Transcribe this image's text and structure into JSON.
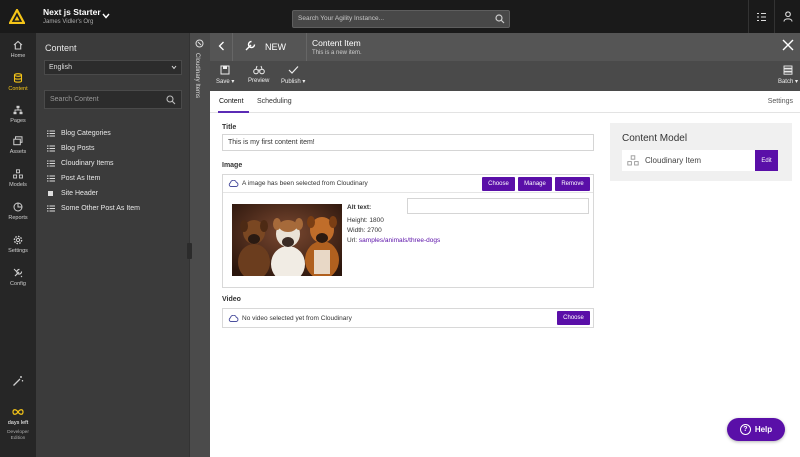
{
  "colors": {
    "accent": "#5a0fa8",
    "logo": "#f5c518",
    "topbar": "#1a1a1a"
  },
  "topbar": {
    "org_name": "Next js Starter",
    "org_sub": "James Vidler's Org",
    "search_placeholder": "Search Your Agility Instance..."
  },
  "nav": {
    "items": [
      {
        "label": "Home",
        "icon": "home-icon"
      },
      {
        "label": "Content",
        "icon": "database-icon"
      },
      {
        "label": "Pages",
        "icon": "sitemap-icon"
      },
      {
        "label": "Assets",
        "icon": "images-icon"
      },
      {
        "label": "Models",
        "icon": "models-icon"
      },
      {
        "label": "Reports",
        "icon": "chart-icon"
      },
      {
        "label": "Settings",
        "icon": "gear-icon"
      },
      {
        "label": "Config",
        "icon": "wrench-icon"
      }
    ],
    "days_label": "days left",
    "edition": "Developer Edition"
  },
  "content_panel": {
    "title": "Content",
    "language": "English",
    "search_placeholder": "Search Content",
    "tree": [
      {
        "label": "Blog Categories",
        "icon": "list-icon"
      },
      {
        "label": "Blog Posts",
        "icon": "list-icon"
      },
      {
        "label": "Cloudinary Items",
        "icon": "list-icon"
      },
      {
        "label": "Post As Item",
        "icon": "list-icon"
      },
      {
        "label": "Site Header",
        "icon": "square-icon"
      },
      {
        "label": "Some Other Post As Item",
        "icon": "list-icon"
      }
    ]
  },
  "strip": {
    "label": "Cloudinary Items"
  },
  "item": {
    "new_label": "NEW",
    "title": "Content Item",
    "subtitle": "This is a new item.",
    "toolbar": {
      "save": "Save",
      "preview": "Preview",
      "publish": "Publish",
      "batch": "Batch"
    }
  },
  "tabs": {
    "content": "Content",
    "scheduling": "Scheduling",
    "settings": "Settings"
  },
  "form": {
    "title_label": "Title",
    "title_value": "This is my first content item!",
    "image_label": "Image",
    "image_status": "A image has been selected from Cloudinary",
    "choose": "Choose",
    "manage": "Manage",
    "remove": "Remove",
    "alt_text": "Alt text:",
    "height": "Height: 1800",
    "width": "Width: 2700",
    "url_prefix": "Url:",
    "url_value": "samples/animals/three-dogs",
    "video_label": "Video",
    "video_status": "No video selected yet from Cloudinary",
    "video_choose": "Choose"
  },
  "content_model": {
    "title": "Content Model",
    "item": "Cloudinary Item",
    "edit": "Edit"
  },
  "help": {
    "label": "Help"
  }
}
